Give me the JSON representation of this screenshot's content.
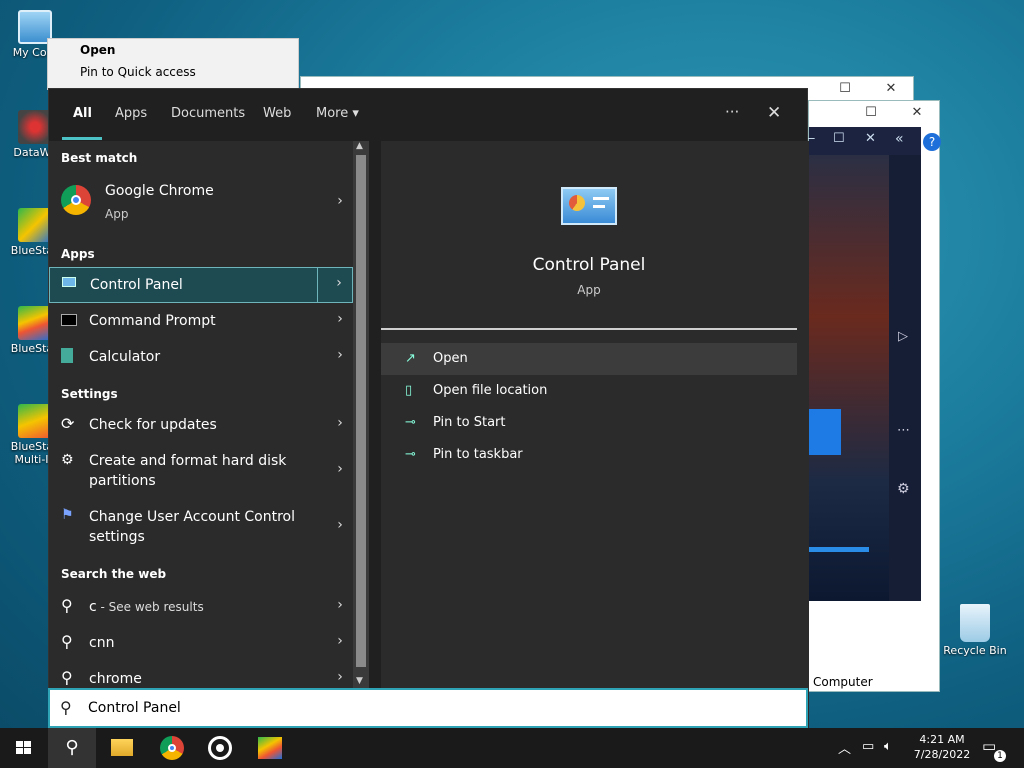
{
  "desktop": {
    "icons": [
      {
        "label": "My Com",
        "icon": "computer-icon"
      },
      {
        "label": "DataWa",
        "icon": "app-icon"
      },
      {
        "label": "BlueStac",
        "icon": "bluestacks-icon"
      },
      {
        "label": "BlueStac",
        "icon": "bluestacks-icon"
      },
      {
        "label": "BlueStac",
        "icon": "bluestacks-multi-icon"
      },
      {
        "label": "Multi-In",
        "icon": "bluestacks-multi-icon"
      },
      {
        "label": "Recycle Bin",
        "icon": "recycle-bin-icon"
      }
    ]
  },
  "context_menu": {
    "items": [
      "Open",
      "Pin to Quick access"
    ]
  },
  "background_window": {
    "status_text": "Computer"
  },
  "search": {
    "tabs": [
      "All",
      "Apps",
      "Documents",
      "Web",
      "More"
    ],
    "more_arrow": "▾",
    "ellipsis": "···",
    "close": "✕",
    "sections": {
      "best_match": "Best match",
      "apps": "Apps",
      "settings": "Settings",
      "web": "Search the web"
    },
    "best_match": {
      "name": "Google Chrome",
      "type": "App"
    },
    "apps": [
      "Control Panel",
      "Command Prompt",
      "Calculator"
    ],
    "settings": [
      "Check for updates",
      "Create and format hard disk partitions",
      "Change User Account Control settings"
    ],
    "web": [
      {
        "prefix": "c",
        "suffix": " - See web results"
      },
      {
        "prefix": "cnn",
        "suffix": ""
      },
      {
        "prefix": "chrome",
        "suffix": ""
      }
    ],
    "detail": {
      "name": "Control Panel",
      "type": "App",
      "actions": [
        "Open",
        "Open file location",
        "Pin to Start",
        "Pin to taskbar"
      ]
    },
    "query": "Control Panel"
  },
  "taskbar": {
    "time": "4:21 AM",
    "date": "7/28/2022",
    "notification_count": "1"
  },
  "colors": {
    "accent": "#4cc2c7",
    "panel_bg": "#202020",
    "list_bg": "#2b2b2b",
    "selected_bg": "#1e4a52"
  }
}
